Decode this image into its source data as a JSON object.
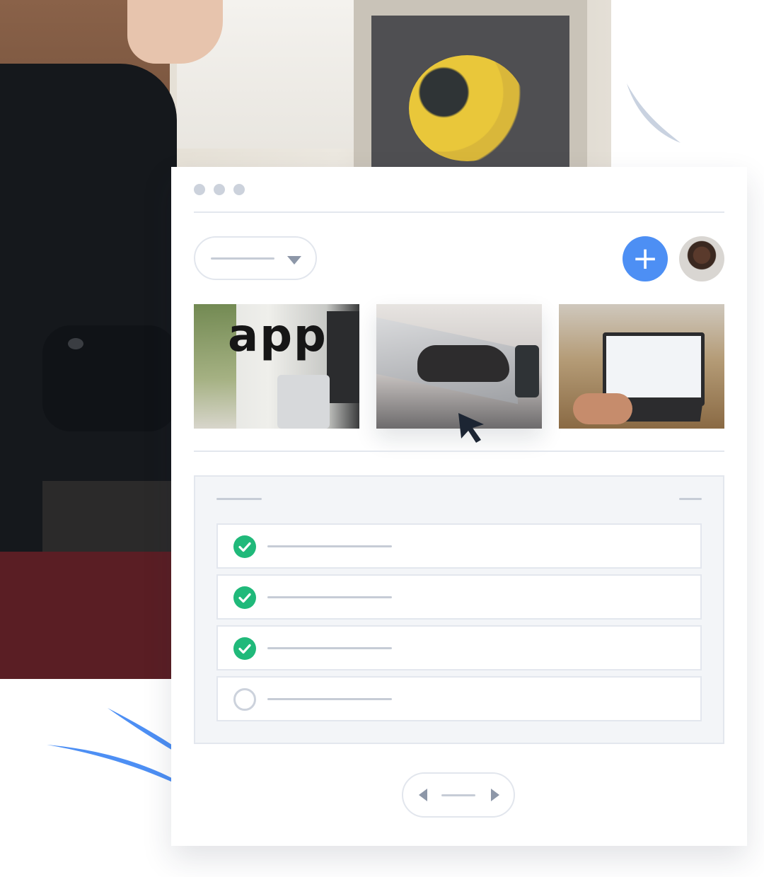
{
  "thumbnails": [
    {
      "name": "app-sign-photo",
      "text": "app"
    },
    {
      "name": "typing-on-laptop-photo"
    },
    {
      "name": "laptop-dashboard-photo"
    }
  ],
  "add_button": {
    "icon": "plus-icon",
    "glyph": "+"
  },
  "tasks": [
    {
      "done": true
    },
    {
      "done": true
    },
    {
      "done": true
    },
    {
      "done": false
    }
  ],
  "colors": {
    "accent": "#4d8ff4",
    "success": "#20b97a",
    "placeholder": "#c6ccd6",
    "stroke_light": "#c9d2e0",
    "stroke_blue": "#4d8ff4"
  }
}
